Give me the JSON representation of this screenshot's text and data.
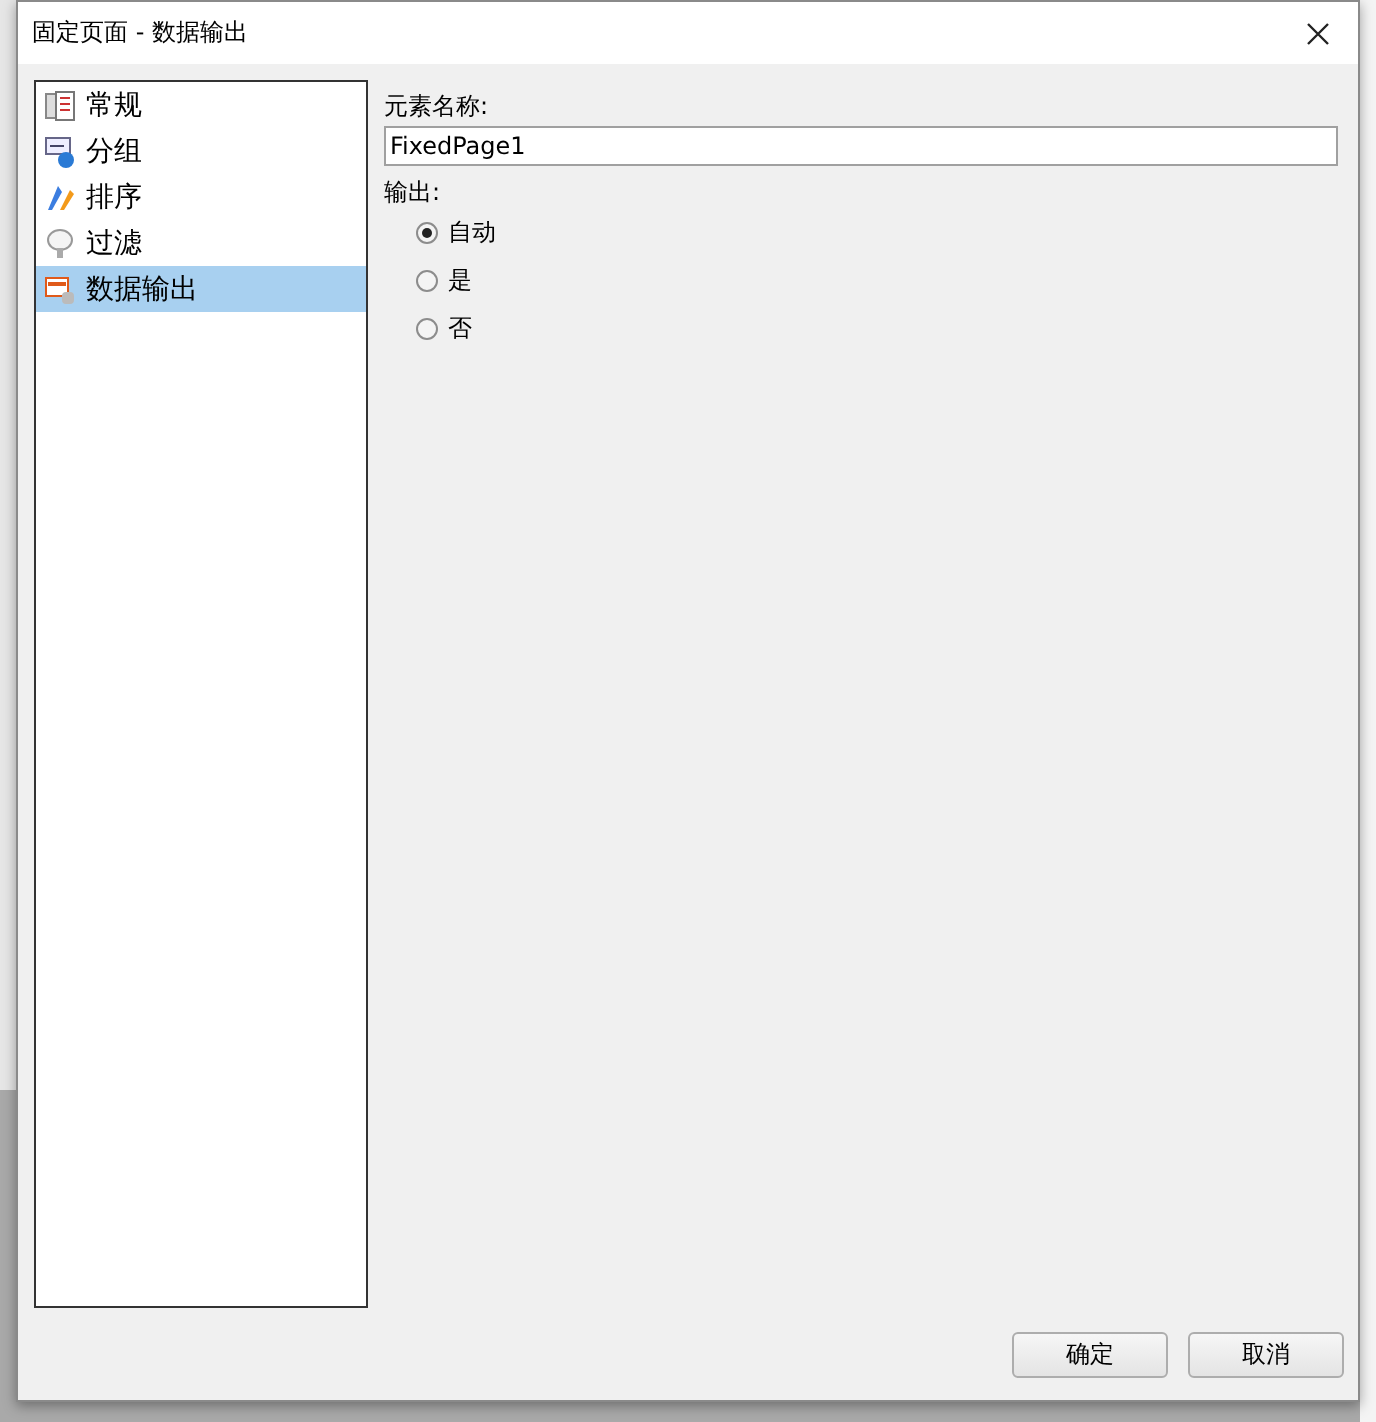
{
  "window": {
    "title": "固定页面 - 数据输出"
  },
  "sidebar": {
    "items": [
      {
        "label": "常规",
        "selected": false
      },
      {
        "label": "分组",
        "selected": false
      },
      {
        "label": "排序",
        "selected": false
      },
      {
        "label": "过滤",
        "selected": false
      },
      {
        "label": "数据输出",
        "selected": true
      }
    ]
  },
  "name_field": {
    "label": "元素名称:",
    "value": "FixedPage1"
  },
  "output": {
    "label": "输出:",
    "options": [
      {
        "label": "自动",
        "selected": true
      },
      {
        "label": "是",
        "selected": false
      },
      {
        "label": "否",
        "selected": false
      }
    ]
  },
  "buttons": [
    "确定",
    "取消"
  ]
}
